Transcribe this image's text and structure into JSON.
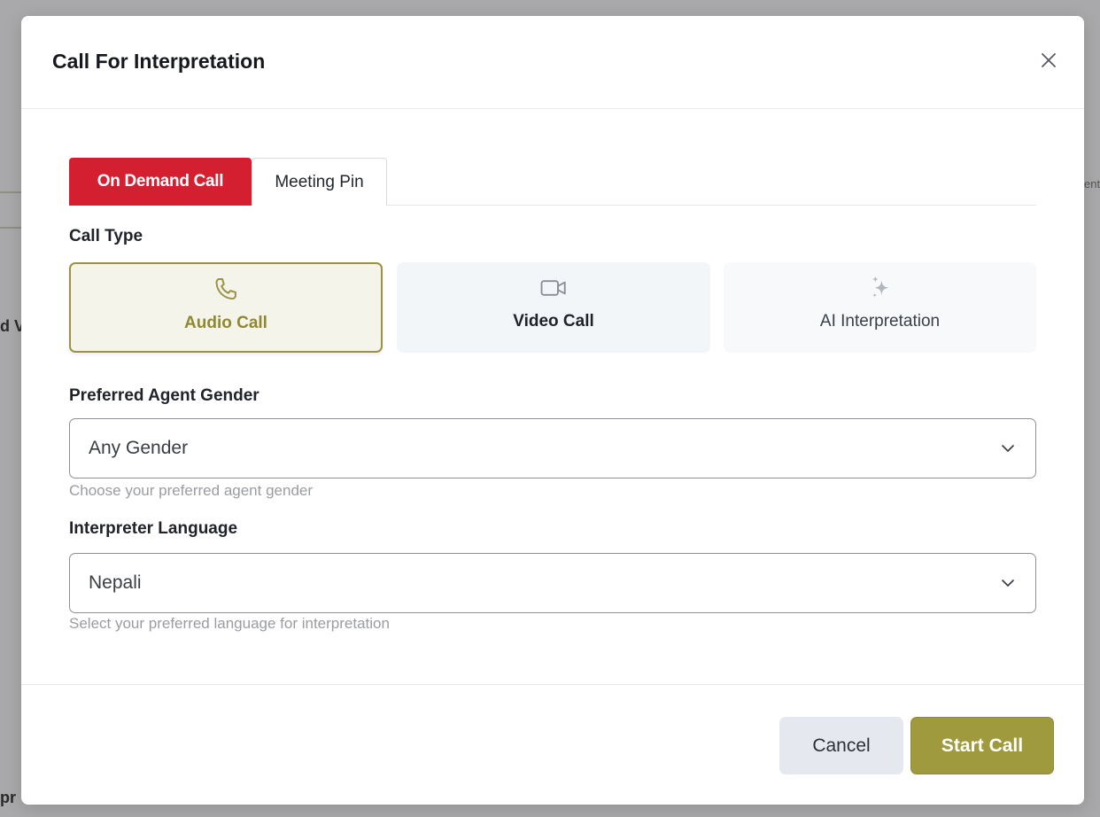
{
  "background": {
    "fragment_left": "d V",
    "fragment_bottom": "pr",
    "fragment_right": "ent"
  },
  "modal": {
    "title": "Call For Interpretation"
  },
  "tabs": [
    {
      "label": "On Demand Call",
      "active": true
    },
    {
      "label": "Meeting Pin",
      "active": false
    }
  ],
  "call_type": {
    "label": "Call Type",
    "options": [
      {
        "label": "Audio Call",
        "icon": "phone-icon",
        "selected": true
      },
      {
        "label": "Video Call",
        "icon": "video-camera-icon",
        "selected": false
      },
      {
        "label": "AI Interpretation",
        "icon": "sparkles-icon",
        "selected": false
      }
    ]
  },
  "gender": {
    "label": "Preferred Agent Gender",
    "value": "Any Gender",
    "hint": "Choose your preferred agent gender"
  },
  "language": {
    "label": "Interpreter Language",
    "value": "Nepali",
    "hint": "Select your preferred language for interpretation"
  },
  "footer": {
    "cancel_label": "Cancel",
    "start_label": "Start Call"
  },
  "colors": {
    "active_tab": "#d41f31",
    "accent_olive": "#a09a3e",
    "overlay": "#a9a9ab"
  }
}
